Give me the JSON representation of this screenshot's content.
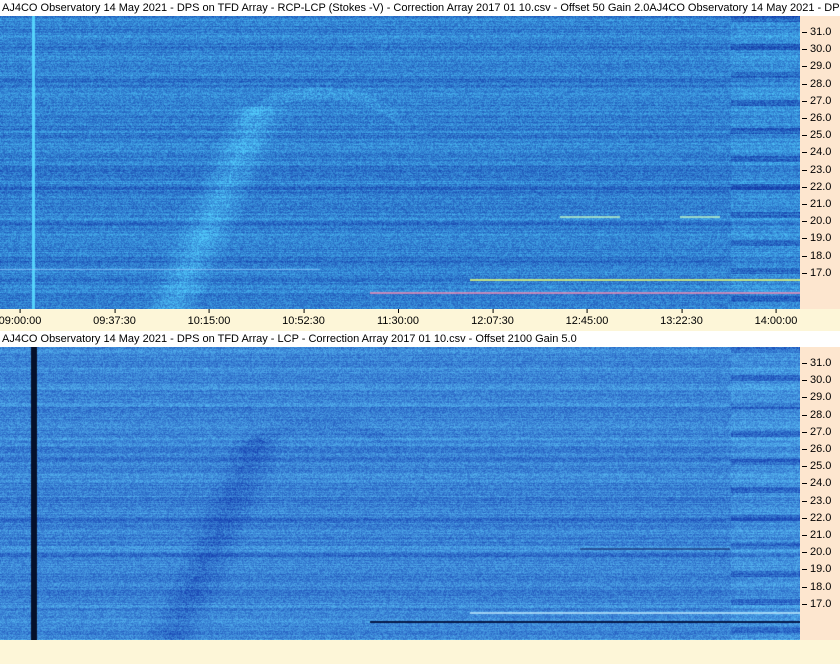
{
  "panels": [
    {
      "title": "AJ4CO Observatory 14 May 2021  -  DPS on TFD Array  -  RCP-LCP (Stokes -V)  -  Correction Array 2017 01 10.csv  -  Offset 50  Gain 2.0AJ4CO Observatory 14 May 2021  -  DP",
      "variant": "stokes"
    },
    {
      "title": "AJ4CO Observatory 14 May 2021  -  DPS on TFD Array  -  LCP  -  Correction Array 2017 01 10.csv  -  Offset 2100  Gain 5.0",
      "variant": "lcp"
    }
  ],
  "frequency_ticks": [
    "31.0",
    "30.0",
    "29.0",
    "28.0",
    "27.0",
    "26.0",
    "25.0",
    "24.0",
    "23.0",
    "22.0",
    "21.0",
    "20.0",
    "19.0",
    "18.0",
    "17.0"
  ],
  "time_ticks": [
    "09:00:00",
    "09:37:30",
    "10:15:00",
    "10:52:30",
    "11:30:00",
    "12:07:30",
    "12:45:00",
    "13:22:30",
    "14:00:00"
  ],
  "colors": {
    "background_blue": "#1e4fd8",
    "axis_bg": "#fde6cf",
    "strip_bg": "#fdf6d8"
  }
}
